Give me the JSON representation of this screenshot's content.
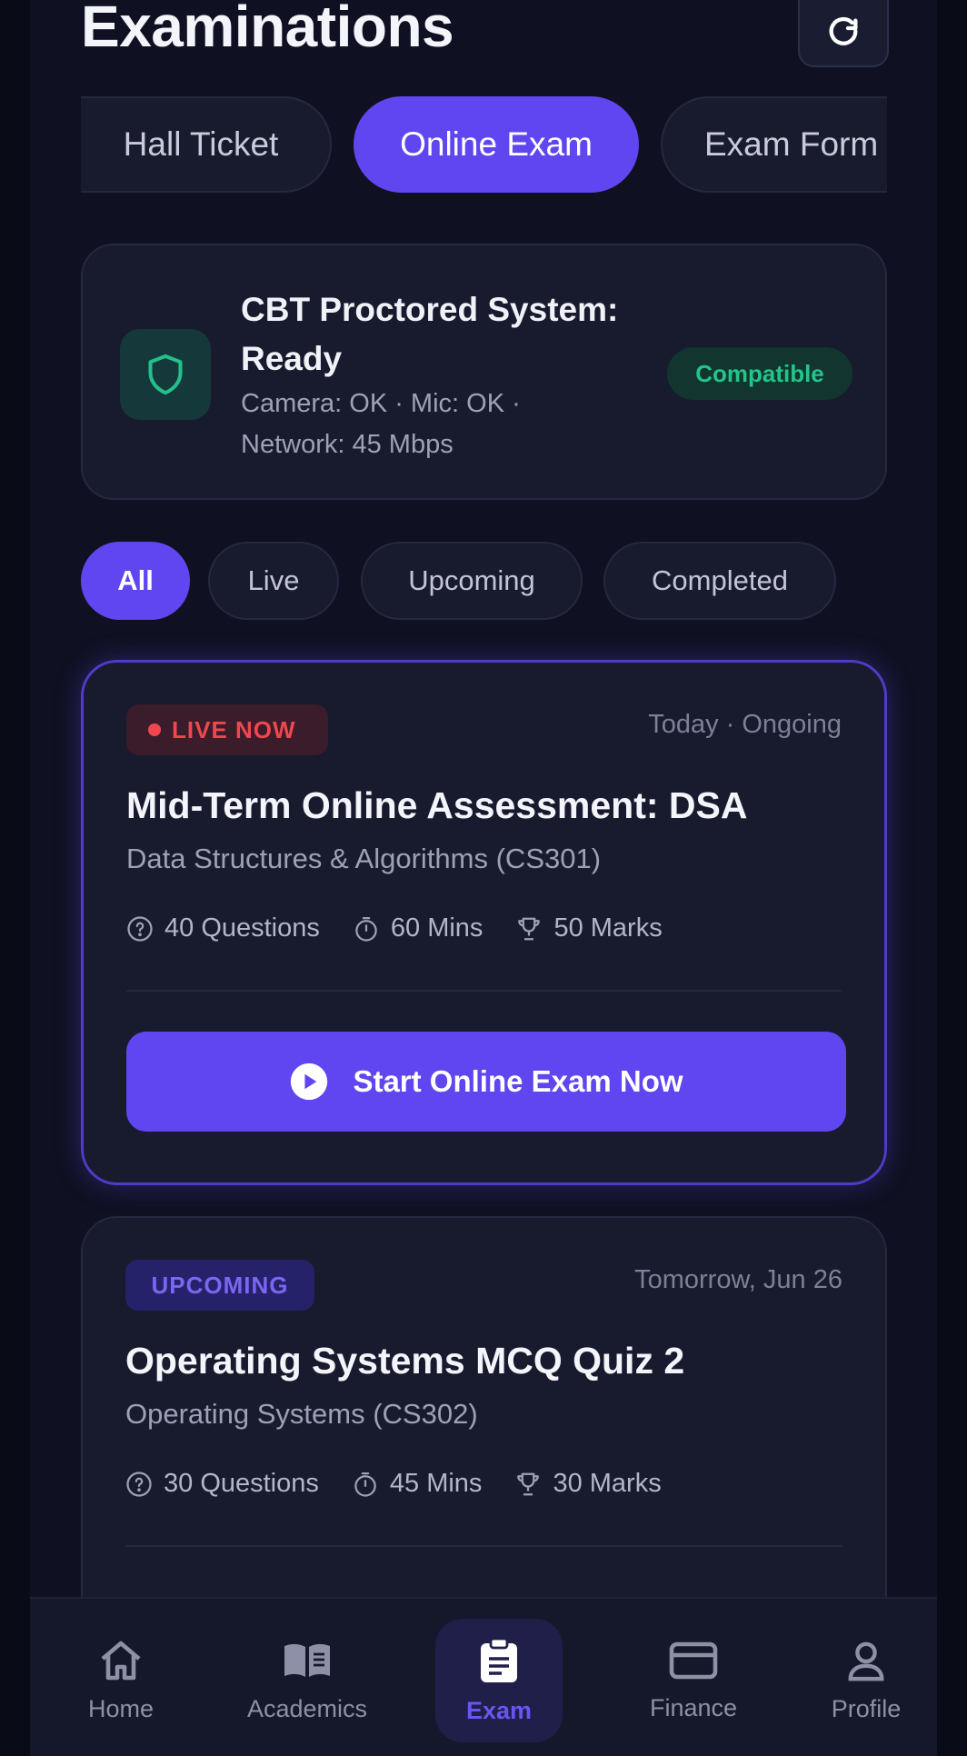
{
  "header": {
    "title": "Examinations",
    "refresh_icon": "refresh-icon"
  },
  "top_tabs": [
    {
      "label": "Hall Ticket",
      "active": false
    },
    {
      "label": "Online Exam",
      "active": true
    },
    {
      "label": "Exam Form",
      "active": false
    }
  ],
  "system_card": {
    "icon": "shield-icon",
    "title": "CBT Proctored System: Ready",
    "status_line": "Camera: OK · Mic: OK · Network: 45 Mbps",
    "badge": "Compatible"
  },
  "filters": [
    {
      "label": "All",
      "active": true
    },
    {
      "label": "Live",
      "active": false
    },
    {
      "label": "Upcoming",
      "active": false
    },
    {
      "label": "Completed",
      "active": false
    }
  ],
  "exams": [
    {
      "status": "LIVE NOW",
      "date": "Today · Ongoing",
      "title": "Mid-Term Online Assessment: DSA",
      "subject": "Data Structures & Algorithms (CS301)",
      "questions": "40 Questions",
      "duration": "60 Mins",
      "marks": "50 Marks",
      "action": "Start Online Exam Now"
    },
    {
      "status": "UPCOMING",
      "date": "Tomorrow, Jun 26",
      "title": "Operating Systems MCQ Quiz 2",
      "subject": "Operating Systems (CS302)",
      "questions": "30 Questions",
      "duration": "45 Mins",
      "marks": "30 Marks"
    }
  ],
  "nav": [
    {
      "label": "Home",
      "icon": "home-icon",
      "active": false
    },
    {
      "label": "Academics",
      "icon": "book-icon",
      "active": false
    },
    {
      "label": "Exam",
      "icon": "clipboard-icon",
      "active": true
    },
    {
      "label": "Finance",
      "icon": "credit-card-icon",
      "active": false
    },
    {
      "label": "Profile",
      "icon": "user-icon",
      "active": false
    }
  ],
  "colors": {
    "background": "#0f1122",
    "card": "#181a2e",
    "accent": "#6046f0",
    "live": "#f0474f",
    "success": "#23c48a"
  }
}
